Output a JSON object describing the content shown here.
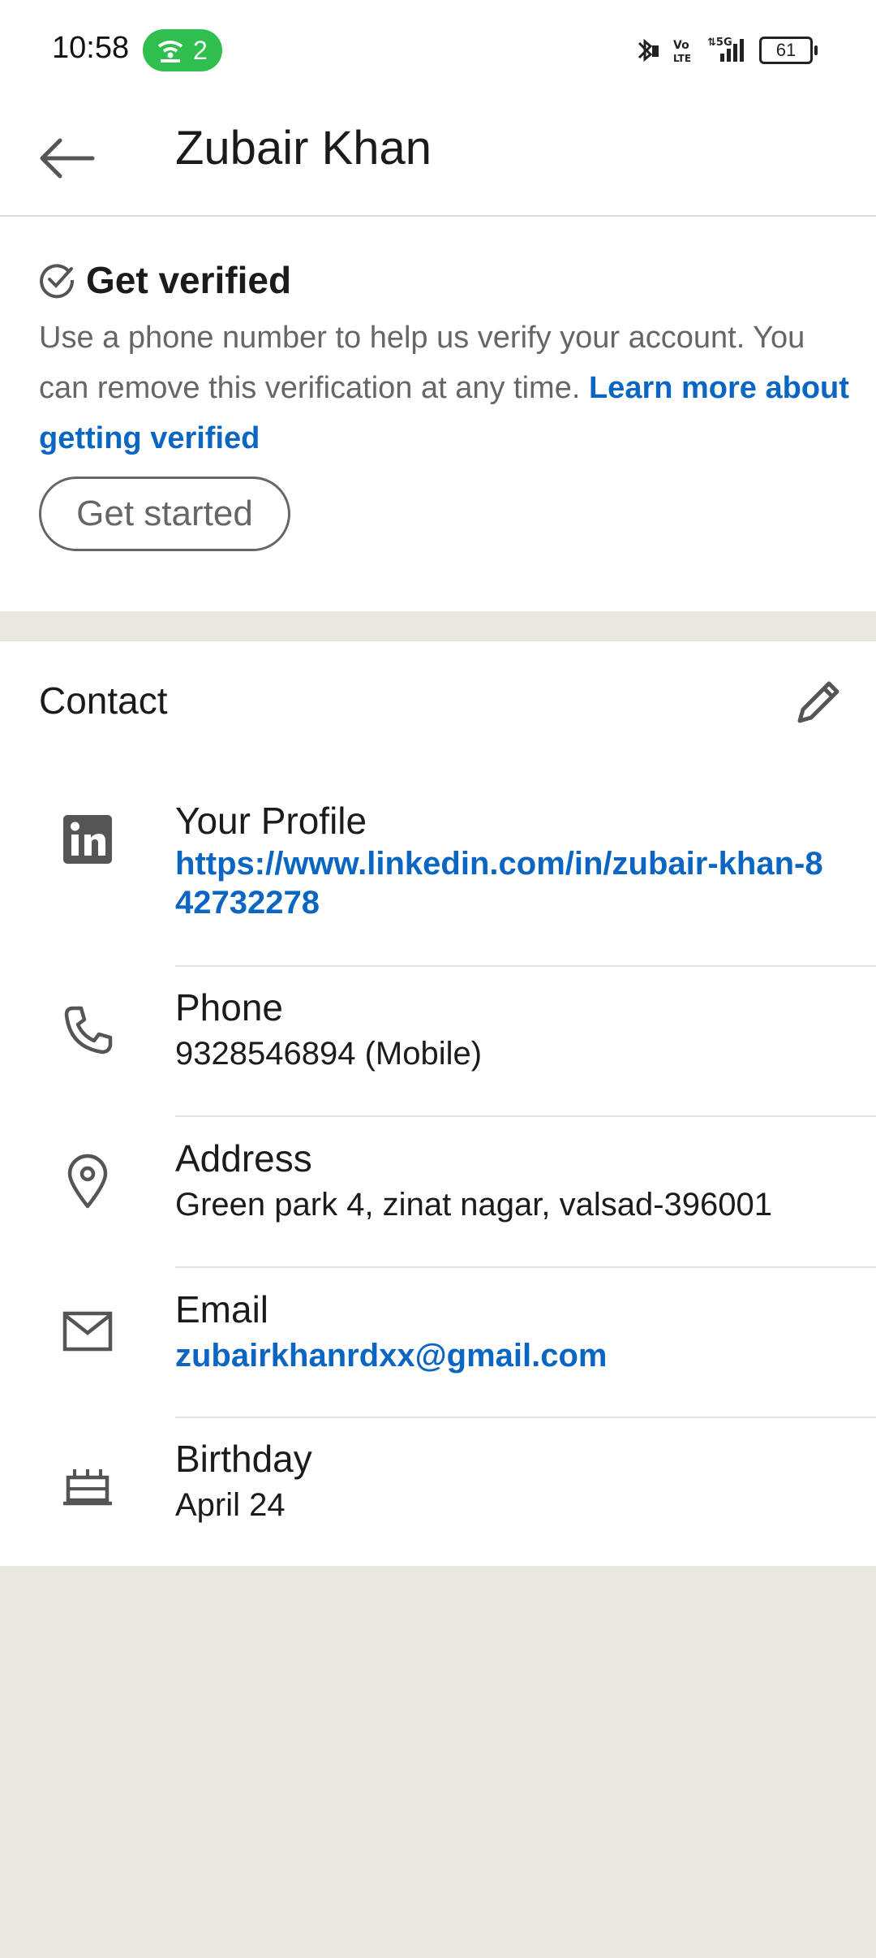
{
  "status": {
    "time": "10:58",
    "hotspot_count": "2",
    "battery": "61"
  },
  "header": {
    "title": "Zubair Khan"
  },
  "verify": {
    "title": "Get verified",
    "text": "Use a phone number to help us verify your account. You can remove this verification at any time.",
    "link": "Learn more about getting verified",
    "button": "Get started"
  },
  "contact": {
    "label": "Contact",
    "items": [
      {
        "label": "Your Profile",
        "value": "https://www.linkedin.com/in/zubair-khan-842732278"
      },
      {
        "label": "Phone",
        "value": "9328546894 (Mobile)"
      },
      {
        "label": "Address",
        "value": "Green park 4, zinat nagar, valsad-396001"
      },
      {
        "label": "Email",
        "value": "zubairkhanrdxx@gmail.com"
      },
      {
        "label": "Birthday",
        "value": "April 24"
      }
    ]
  },
  "colors": {
    "link": "#0a66c2",
    "hotspot": "#2fbf4f",
    "background": "#e9e5df"
  }
}
